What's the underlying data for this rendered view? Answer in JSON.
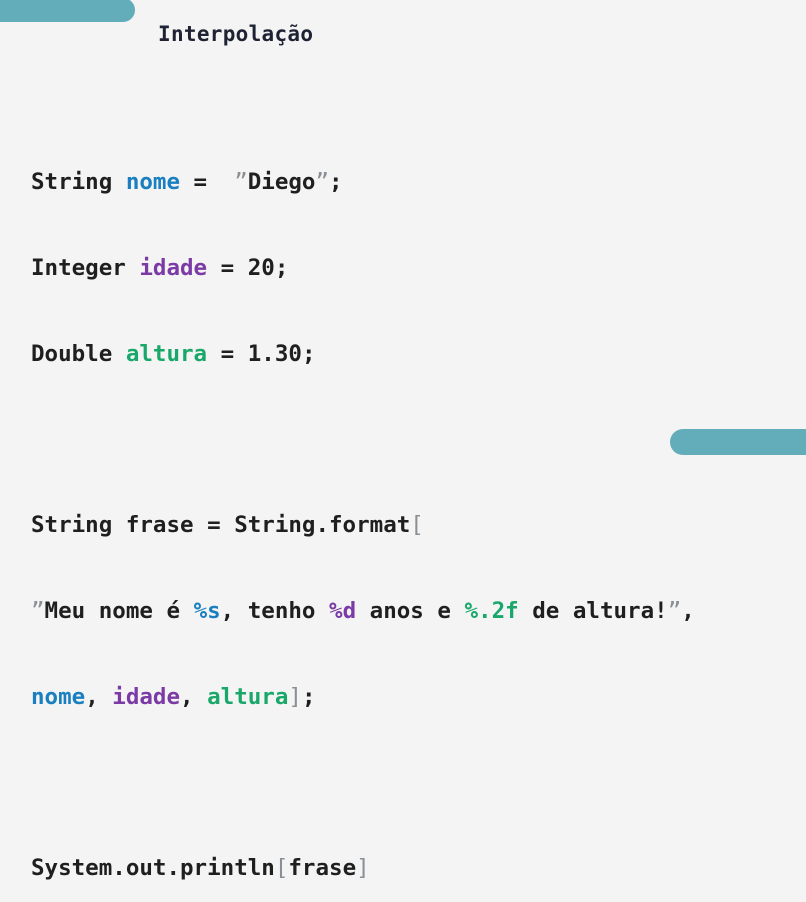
{
  "title": "Interpolação",
  "code": {
    "l1": {
      "type": "String ",
      "var": "nome",
      "eq": " = ",
      "q1": " ”",
      "val": "Diego",
      "q2": "”",
      "end": ";"
    },
    "l2": {
      "type": "Integer ",
      "var": "idade",
      "eq": " = ",
      "val": "20",
      "end": ";"
    },
    "l3": {
      "type": "Double ",
      "var": "altura",
      "eq": " = ",
      "val": "1.30",
      "end": ";"
    },
    "l4": {
      "text": "String frase = String.format",
      "paren": "["
    },
    "l5": {
      "q1": "”",
      "t1": "Meu nome é ",
      "f1": "%s",
      "t2": ", tenho ",
      "f2": "%d",
      "t3": " anos e ",
      "f3": "%.2f",
      "t4": " de altura!",
      "q2": "”",
      "end": ","
    },
    "l6": {
      "v1": "nome",
      "c1": ", ",
      "v2": "idade",
      "c2": ", ",
      "v3": "altura",
      "paren": "]",
      "end": ";"
    },
    "l7": {
      "text": "System.out.println",
      "p1": "[",
      "arg": "frase",
      "p2": "]"
    }
  },
  "colors": {
    "accent": "#62adb9",
    "nome": "#1a7fc1",
    "idade": "#7b3aa5",
    "altura": "#1aa86a"
  }
}
